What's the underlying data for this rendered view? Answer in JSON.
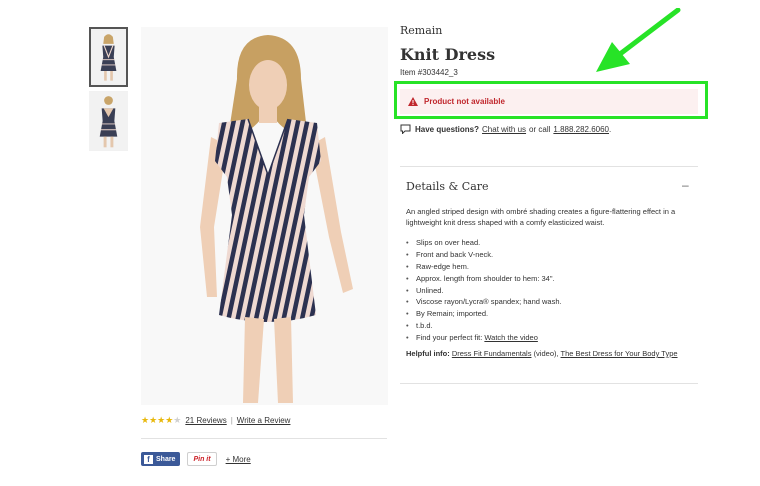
{
  "product": {
    "brand": "Remain",
    "title": "Knit Dress",
    "item_number": "Item #303442_3",
    "availability": "Product not available"
  },
  "colors": {
    "highlight_box": "#27e327",
    "arrow": "#27e327",
    "alert_text": "#c0272d",
    "alert_bg": "#fcf0f0",
    "stars": "#e8b80c",
    "facebook": "#3b5998",
    "pinterest": "#cb2027"
  },
  "icons": {
    "alert": "warning-triangle-icon",
    "questions": "chat-bubble-icon",
    "collapse": "minus-icon"
  },
  "questions": {
    "label": "Have questions?",
    "chat_link": "Chat with us",
    "or_call": "or call",
    "phone": "1.888.282.6060",
    "period": "."
  },
  "details": {
    "title": "Details & Care",
    "toggle": "–",
    "description": "An angled striped design with ombré shading creates a figure-flattering effect in a lightweight knit dress shaped with a comfy elasticized waist.",
    "bullets": [
      "Slips on over head.",
      "Front and back V-neck.",
      "Raw-edge hem.",
      "Approx. length from shoulder to hem: 34\".",
      "Unlined.",
      "Viscose rayon/Lycra® spandex; hand wash.",
      "By Remain; imported.",
      "t.b.d."
    ],
    "fit_label": "Find your perfect fit:",
    "fit_link": "Watch the video",
    "helpful_label": "Helpful info:",
    "helpful_link1": "Dress Fit Fundamentals",
    "helpful_middle": "(video),",
    "helpful_link2": "The Best Dress for Your Body Type"
  },
  "reviews": {
    "rating": 4,
    "max_rating": 5,
    "count_link": "21 Reviews",
    "separator": "|",
    "write_link": "Write a Review"
  },
  "social": {
    "facebook_f": "f",
    "facebook_label": "Share",
    "pinterest_label": "Pin it",
    "more_label": "+ More"
  }
}
